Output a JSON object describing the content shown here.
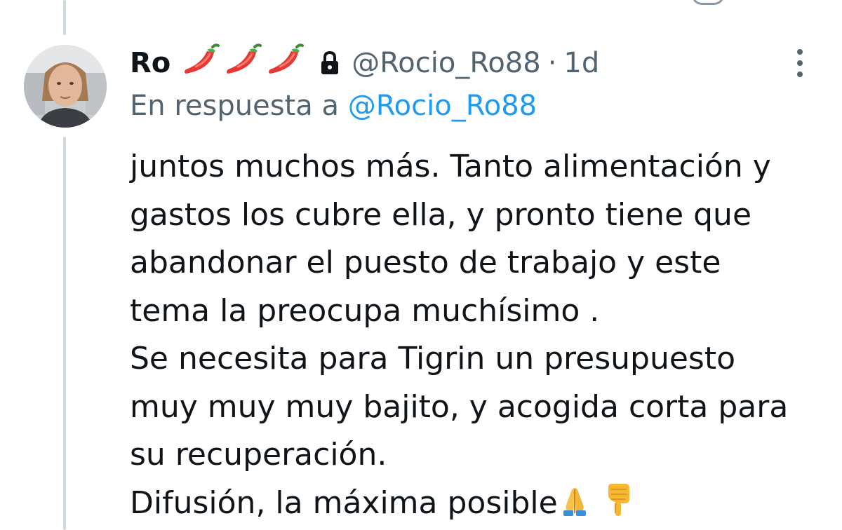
{
  "tweet": {
    "author": {
      "display_name": "Ro",
      "name_emojis": [
        "chili-pepper-icon",
        "chili-pepper-icon",
        "chili-pepper-icon"
      ],
      "protected": true,
      "handle": "@Rocio_Ro88"
    },
    "separator": "·",
    "time": "1d",
    "reply_prefix": "En respuesta a",
    "reply_to": "@Rocio_Ro88",
    "body_lines": [
      "juntos muchos más. Tanto alimentación y",
      "gastos los cubre ella, y pronto tiene que",
      "abandonar el puesto de trabajo y este",
      "tema la preocupa muchísimo .",
      "Se necesita para Tigrin un presupuesto",
      "muy muy muy bajito, y acogida corta para",
      "su recuperación.",
      "Difusión, la máxima posible"
    ],
    "body_end_emojis": [
      "folded-hands-icon",
      "pointing-down-icon"
    ]
  },
  "colors": {
    "text_primary": "#0f1419",
    "text_secondary": "#536471",
    "link": "#1d9bf0",
    "thread_line": "#cfd9de"
  }
}
